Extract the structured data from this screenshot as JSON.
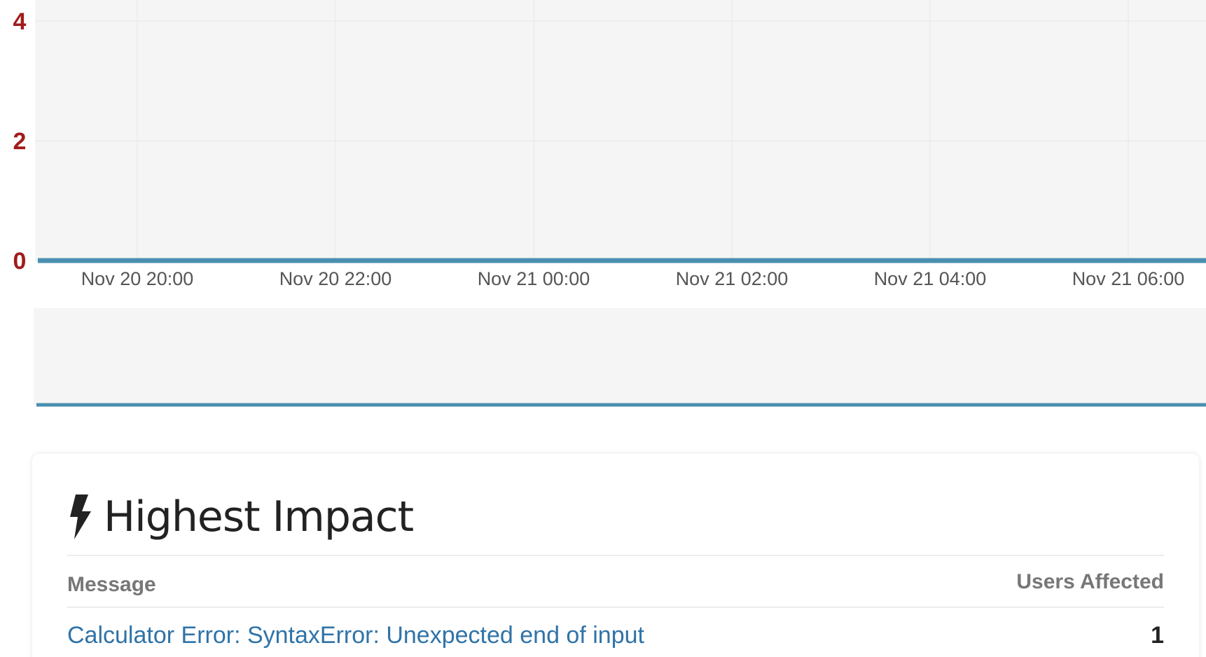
{
  "chart_data": {
    "type": "line",
    "y_ticks": [
      "4",
      "2",
      "0"
    ],
    "x_ticks": [
      "Nov 20 20:00",
      "Nov 20 22:00",
      "Nov 21 00:00",
      "Nov 21 02:00",
      "Nov 21 04:00",
      "Nov 21 06:00"
    ],
    "ylim": [
      0,
      4
    ],
    "series": [
      {
        "values": [
          0,
          0,
          0,
          0,
          0,
          0
        ]
      }
    ],
    "series_color": "#4a8fb0",
    "grid": true
  },
  "colors": {
    "y_tick": "#a11c1c",
    "line": "#4a8fb0",
    "plot_bg": "#f5f5f5",
    "link": "#2f73a8"
  },
  "highest_impact": {
    "icon": "bolt-icon",
    "title": "Highest Impact",
    "columns": {
      "message": "Message",
      "users_affected": "Users Affected"
    },
    "rows": [
      {
        "message": "Calculator Error: SyntaxError: Unexpected end of input",
        "users_affected": "1"
      }
    ]
  }
}
